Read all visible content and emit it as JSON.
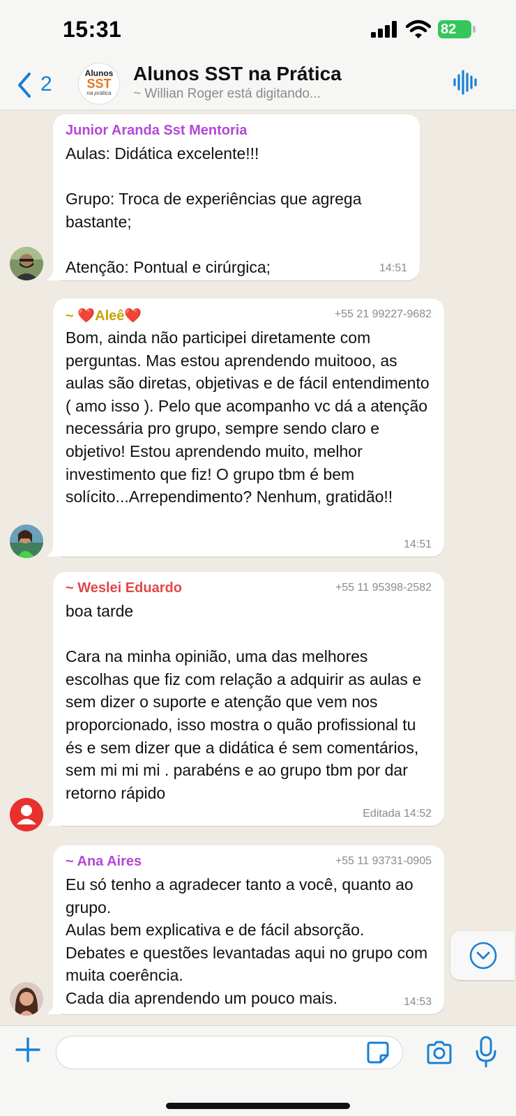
{
  "status_bar": {
    "time": "15:31",
    "battery": "82"
  },
  "header": {
    "back_count": "2",
    "group_logo": {
      "line1": "Alunos",
      "line2": "SST",
      "line3": "na prática"
    },
    "title": "Alunos SST na Prática",
    "subtitle": "~ Willian Roger está digitando..."
  },
  "messages": [
    {
      "sender": "Junior Aranda Sst Mentoria",
      "sender_color": "#b347d6",
      "phone": "",
      "text": "Aulas: Didática excelente!!!\n\nGrupo: Troca de experiências que agrega bastante;\n\nAtenção: Pontual e cirúrgica;",
      "time": "14:51",
      "avatar": "photo-man"
    },
    {
      "sender": "~ ❤️Aleê❤️",
      "sender_color": "#c9a400",
      "phone": "+55 21 99227-9682",
      "text": "Bom, ainda não participei diretamente com perguntas. Mas estou aprendendo muitooo, as aulas são diretas, objetivas e de fácil entendimento ( amo isso ). Pelo que acompanho vc dá a  atenção necessária pro grupo, sempre sendo claro e objetivo! Estou aprendendo muito, melhor investimento que fiz! O grupo tbm é bem solícito...Arrependimento? Nenhum, gratidão!!",
      "time": "14:51",
      "avatar": "photo-woman-green"
    },
    {
      "sender": "~ Weslei Eduardo",
      "sender_color": "#e04848",
      "phone": "+55 11 95398-2582",
      "text": "boa tarde\n\nCara na minha opinião, uma das melhores escolhas que fiz com relação a adquirir as aulas e sem dizer o suporte e atenção que vem nos proporcionado, isso mostra o quão profissional tu és e sem dizer que a didática é sem comentários, sem mi mi mi . parabéns e ao grupo tbm por dar retorno rápido",
      "time": "Editada 14:52",
      "avatar": "default-user"
    },
    {
      "sender": "~ Ana Aires",
      "sender_color": "#b347d6",
      "phone": "+55 11 93731-0905",
      "text": "Eu só tenho a agradecer tanto a você, quanto ao grupo.\nAulas bem explicativa e de fácil absorção.\nDebates e questões levantadas aqui no grupo com muita coerência.\nCada dia aprendendo um pouco mais.",
      "time": "14:53",
      "avatar": "photo-woman"
    }
  ],
  "input": {
    "placeholder": ""
  },
  "colors": {
    "accent": "#1a7fd4",
    "chat_bg": "#efeae2",
    "battery": "#34c759"
  },
  "icons": [
    "chevron-left-icon",
    "audio-wave-icon",
    "plus-icon",
    "sticker-icon",
    "camera-icon",
    "microphone-icon",
    "chevron-down-icon"
  ]
}
